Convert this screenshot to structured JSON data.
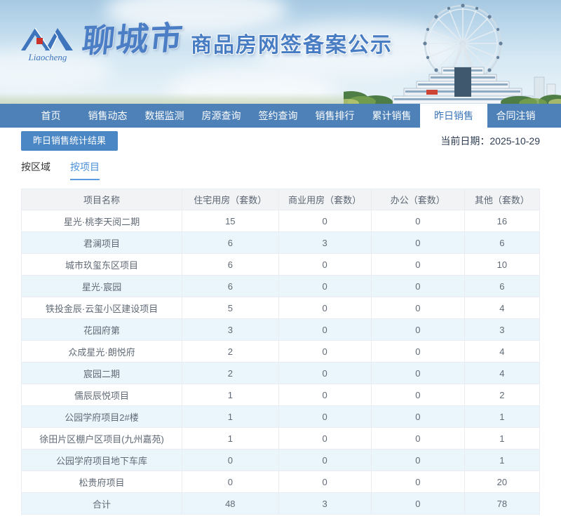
{
  "banner": {
    "logo_script": "Liaocheng",
    "city_name": "聊城市",
    "title": "商品房网签备案公示"
  },
  "nav": {
    "items": [
      {
        "label": "首页",
        "active": false
      },
      {
        "label": "销售动态",
        "active": false
      },
      {
        "label": "数据监测",
        "active": false
      },
      {
        "label": "房源查询",
        "active": false
      },
      {
        "label": "签约查询",
        "active": false
      },
      {
        "label": "销售排行",
        "active": false
      },
      {
        "label": "累计销售",
        "active": false
      },
      {
        "label": "昨日销售",
        "active": true
      },
      {
        "label": "合同注销",
        "active": false
      }
    ]
  },
  "toolbar": {
    "result_button": "昨日销售统计结果",
    "date_label": "当前日期：",
    "date_value": "2025-10-29"
  },
  "view_tabs": [
    {
      "label": "按区域",
      "active": false
    },
    {
      "label": "按项目",
      "active": true
    }
  ],
  "table": {
    "headers": [
      "项目名称",
      "住宅用房（套数）",
      "商业用房（套数）",
      "办公（套数）",
      "其他（套数）"
    ],
    "rows": [
      {
        "name": "星光·桃李天阅二期",
        "residential": "15",
        "commercial": "0",
        "office": "0",
        "other": "16"
      },
      {
        "name": "君澜项目",
        "residential": "6",
        "commercial": "3",
        "office": "0",
        "other": "6"
      },
      {
        "name": "城市玖玺东区项目",
        "residential": "6",
        "commercial": "0",
        "office": "0",
        "other": "10"
      },
      {
        "name": "星光·宸园",
        "residential": "6",
        "commercial": "0",
        "office": "0",
        "other": "6"
      },
      {
        "name": "铁投金辰·云玺小区建设项目",
        "residential": "5",
        "commercial": "0",
        "office": "0",
        "other": "4"
      },
      {
        "name": "花园府第",
        "residential": "3",
        "commercial": "0",
        "office": "0",
        "other": "3"
      },
      {
        "name": "众成星光·朗悦府",
        "residential": "2",
        "commercial": "0",
        "office": "0",
        "other": "4"
      },
      {
        "name": "宸园二期",
        "residential": "2",
        "commercial": "0",
        "office": "0",
        "other": "4"
      },
      {
        "name": "儒辰辰悦项目",
        "residential": "1",
        "commercial": "0",
        "office": "0",
        "other": "2"
      },
      {
        "name": "公园学府项目2#楼",
        "residential": "1",
        "commercial": "0",
        "office": "0",
        "other": "1"
      },
      {
        "name": "徐田片区棚户区项目(九州嘉苑)",
        "residential": "1",
        "commercial": "0",
        "office": "0",
        "other": "1"
      },
      {
        "name": "公园学府项目地下车库",
        "residential": "0",
        "commercial": "0",
        "office": "0",
        "other": "1"
      },
      {
        "name": "松贵府项目",
        "residential": "0",
        "commercial": "0",
        "office": "0",
        "other": "20"
      },
      {
        "name": "合计",
        "residential": "48",
        "commercial": "3",
        "office": "0",
        "other": "78"
      }
    ]
  },
  "colors": {
    "nav_bg": "#4d81b7",
    "nav_active_text": "#3a74b8",
    "button_bg": "#4b87c4",
    "tab_active": "#4a90d9",
    "row_alt_bg": "#eaf6fc",
    "header_bg": "#f2f3f5",
    "logo_blue": "#3d74bc",
    "logo_red": "#c9332b"
  }
}
